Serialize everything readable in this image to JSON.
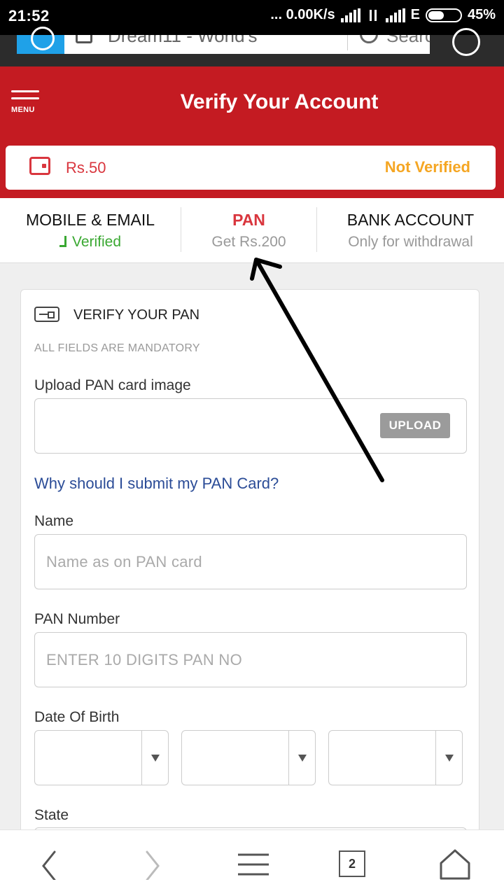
{
  "status_bar": {
    "time": "21:52",
    "speed": "... 0.00K/s",
    "network_type": "E",
    "battery": "45%"
  },
  "browser": {
    "url_text": "Dream11 - World's",
    "search_placeholder": "Search"
  },
  "header": {
    "menu_label": "MENU",
    "title": "Verify Your Account"
  },
  "wallet": {
    "amount": "Rs.50",
    "status": "Not Verified"
  },
  "tabs": [
    {
      "title": "MOBILE & EMAIL",
      "subtitle": "Verified"
    },
    {
      "title": "PAN",
      "subtitle": "Get Rs.200"
    },
    {
      "title": "BANK ACCOUNT",
      "subtitle": "Only for withdrawal"
    }
  ],
  "form": {
    "title": "VERIFY YOUR PAN",
    "mandatory_note": "ALL FIELDS ARE MANDATORY",
    "upload_label": "Upload PAN card image",
    "upload_button": "UPLOAD",
    "why_link": "Why should I submit my PAN Card?",
    "name_label": "Name",
    "name_placeholder": "Name as on PAN card",
    "pan_label": "PAN Number",
    "pan_placeholder": "ENTER 10 DIGITS PAN NO",
    "dob_label": "Date Of Birth",
    "state_label": "State"
  },
  "bottom_nav": {
    "tab_count": "2"
  },
  "colors": {
    "header_red": "#c41b22",
    "accent_red": "#d9363e",
    "not_verified_orange": "#f5a623",
    "verified_green": "#3aa832",
    "link_blue": "#2b4c97"
  }
}
